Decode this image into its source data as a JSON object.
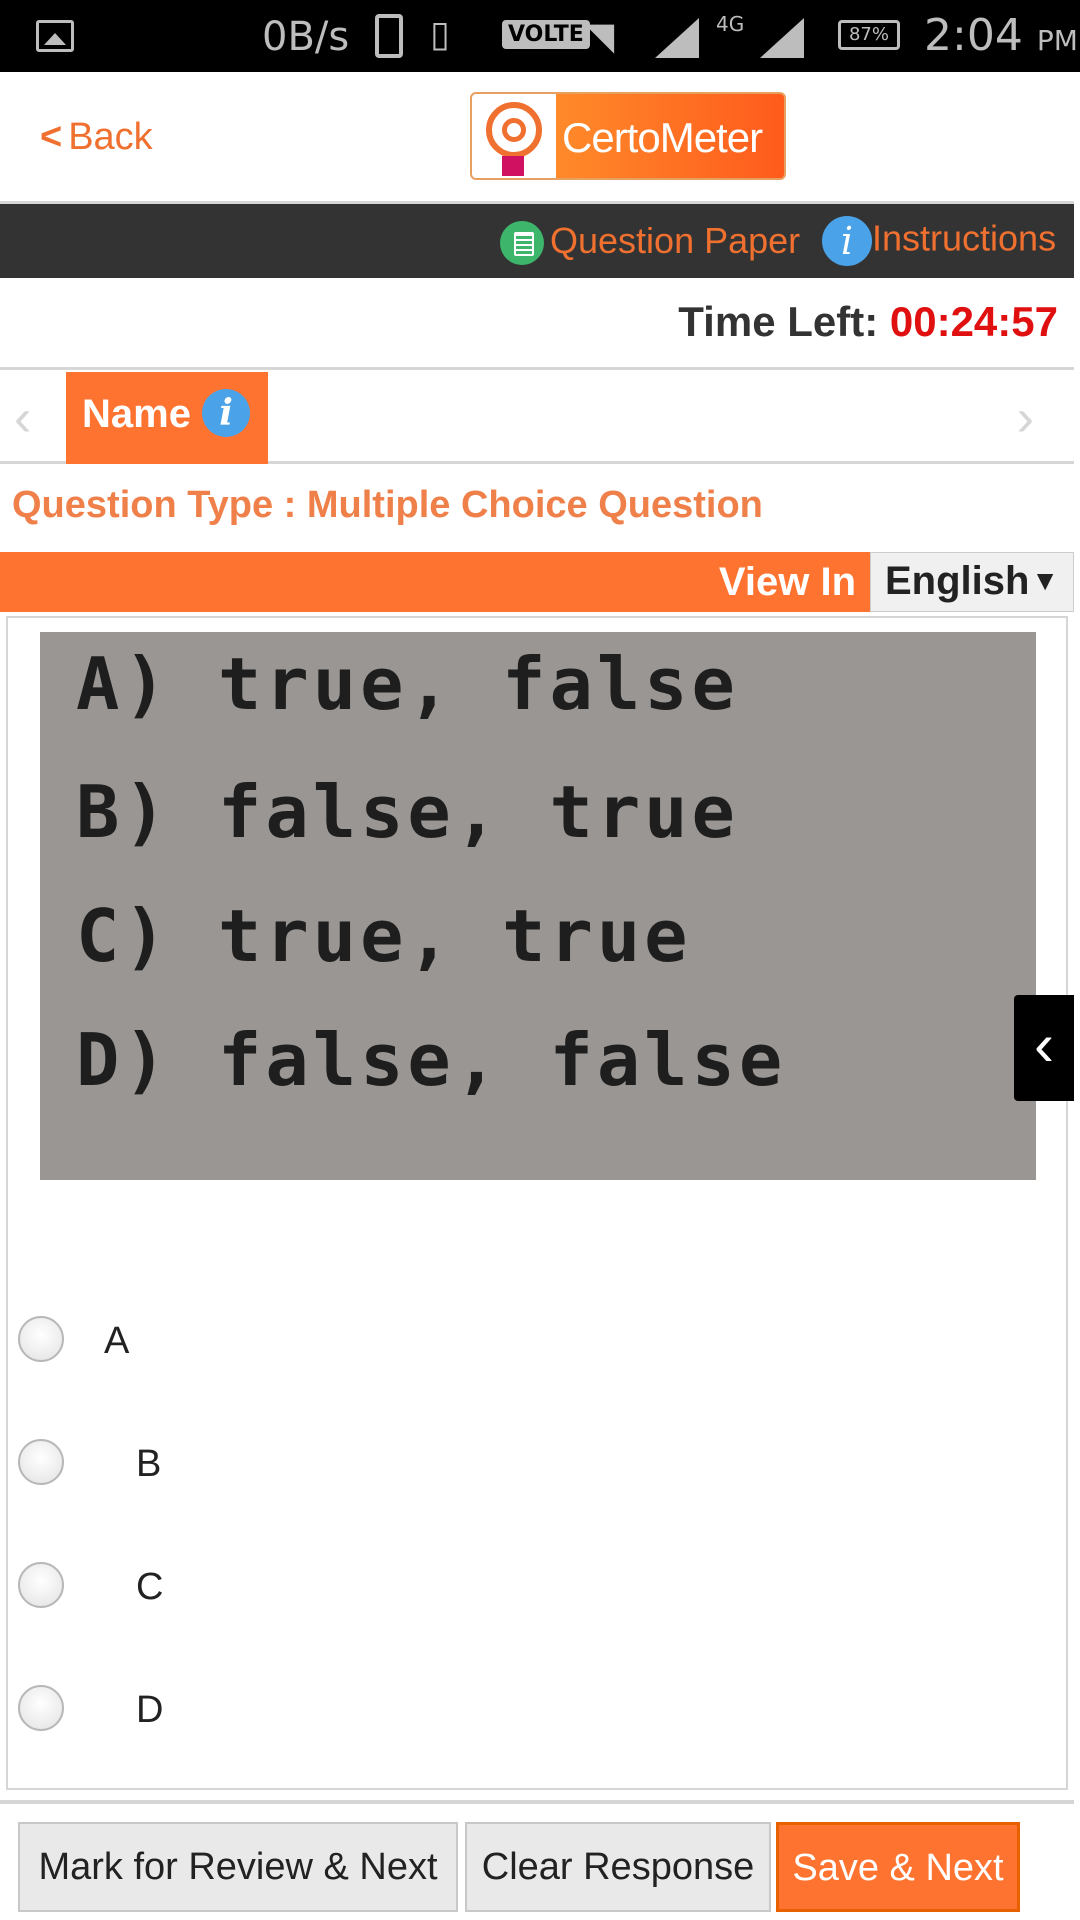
{
  "status_bar": {
    "speed": "0B/s",
    "volte": "VOLTE",
    "network": "4G",
    "battery": "87%",
    "time": "2:04",
    "ampm": "PM"
  },
  "header": {
    "back_label": "Back",
    "logo_text": "CertoMeter"
  },
  "toolbar": {
    "question_paper": "Question Paper",
    "instructions": "Instructions",
    "info_glyph": "i"
  },
  "timer": {
    "label": "Time Left:",
    "value": "00:24:57"
  },
  "section": {
    "tab_label": "Name"
  },
  "question": {
    "type_label": "Question Type : Multiple Choice Question",
    "view_in": "View In",
    "language": "English",
    "image_lines": [
      "A) true,  false",
      "B) false,  true",
      "C) true,  true",
      "D) false,  false"
    ],
    "options": [
      "A",
      "B",
      "C",
      "D"
    ]
  },
  "actions": {
    "mark_review": "Mark for Review & Next",
    "clear": "Clear Response",
    "save": "Save & Next"
  },
  "colors": {
    "accent": "#ff7330",
    "timer": "#e01010",
    "dark_bar": "#333333"
  }
}
